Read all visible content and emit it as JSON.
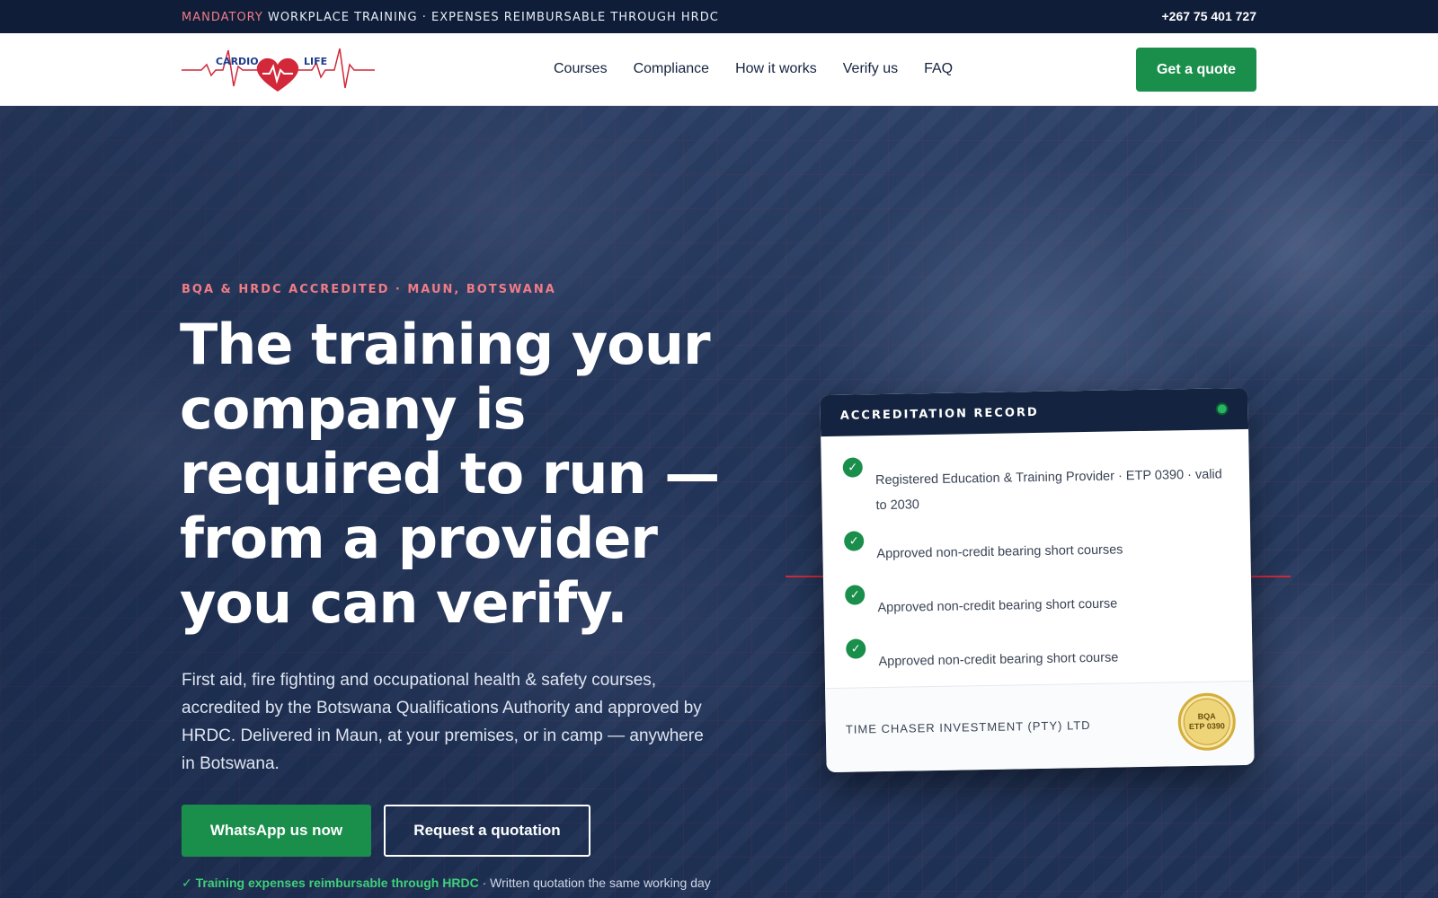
{
  "topbar": {
    "highlight": "MANDATORY",
    "message": " WORKPLACE TRAINING · EXPENSES REIMBURSABLE THROUGH HRDC",
    "phone": "+267 75 401 727"
  },
  "header": {
    "logo_left": "CARDIO",
    "logo_right": "LIFE",
    "nav": [
      "Courses",
      "Compliance",
      "How it works",
      "Verify us",
      "FAQ"
    ],
    "cta": "Get a quote"
  },
  "hero": {
    "eyebrow": "BQA & HRDC ACCREDITED · MAUN, BOTSWANA",
    "headline": "The training your company is required to run — from a provider you can verify.",
    "lede": "First aid, fire fighting and occupational health & safety courses, accredited by the Botswana Qualifications Authority and approved by HRDC. Delivered in Maun, at your premises, or in camp — anywhere in Botswana.",
    "primary_button": "WhatsApp us now",
    "secondary_button": "Request a quotation",
    "footnote_highlight": "✓ Training expenses reimbursable through HRDC",
    "footnote_rest": " · Written quotation the same working day"
  },
  "card": {
    "title": "ACCREDITATION RECORD",
    "items": [
      "Registered Education & Training Provider · ETP 0390 · valid to 2030",
      "Approved non-credit bearing short courses",
      "Approved non-credit bearing short course",
      "Approved non-credit bearing short course"
    ],
    "company": "TIME CHASER INVESTMENT (PTY) LTD",
    "seal_line1": "BQA",
    "seal_line2": "ETP 0390"
  },
  "colors": {
    "navy": "#0f1d38",
    "brand_green": "#1a8e4b",
    "accent_pink": "#f07c86",
    "accent_red": "#d2283a"
  },
  "icons": {
    "check": "check-circle-icon",
    "status": "status-dot-icon"
  }
}
